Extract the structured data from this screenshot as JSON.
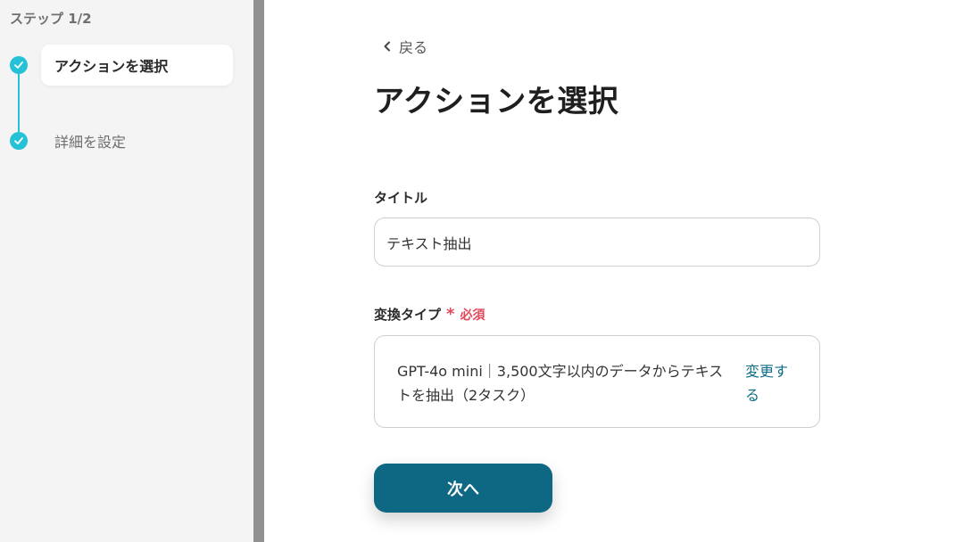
{
  "sidebar": {
    "step_counter": "ステップ 1/2",
    "steps": [
      {
        "label": "アクションを選択",
        "state": "active"
      },
      {
        "label": "詳細を設定",
        "state": "inactive"
      }
    ]
  },
  "main": {
    "back_label": "戻る",
    "page_title": "アクションを選択",
    "title_field": {
      "label": "タイトル",
      "value": "テキスト抽出"
    },
    "type_field": {
      "label": "変換タイプ",
      "required_mark": "*",
      "required_text": "必須",
      "value": "GPT-4o mini｜3,500文字以内のデータからテキストを抽出（2タスク）",
      "change_label": "変更する"
    },
    "next_button_label": "次へ"
  },
  "colors": {
    "accent_cyan": "#25c1d6",
    "primary_button": "#0e6783",
    "link": "#0f6d8a",
    "required": "#e2485a",
    "sidebar_bg": "#f4f4f4",
    "divider": "#919191"
  },
  "icons": {
    "step_done": "check-icon",
    "back": "chevron-left-icon"
  }
}
